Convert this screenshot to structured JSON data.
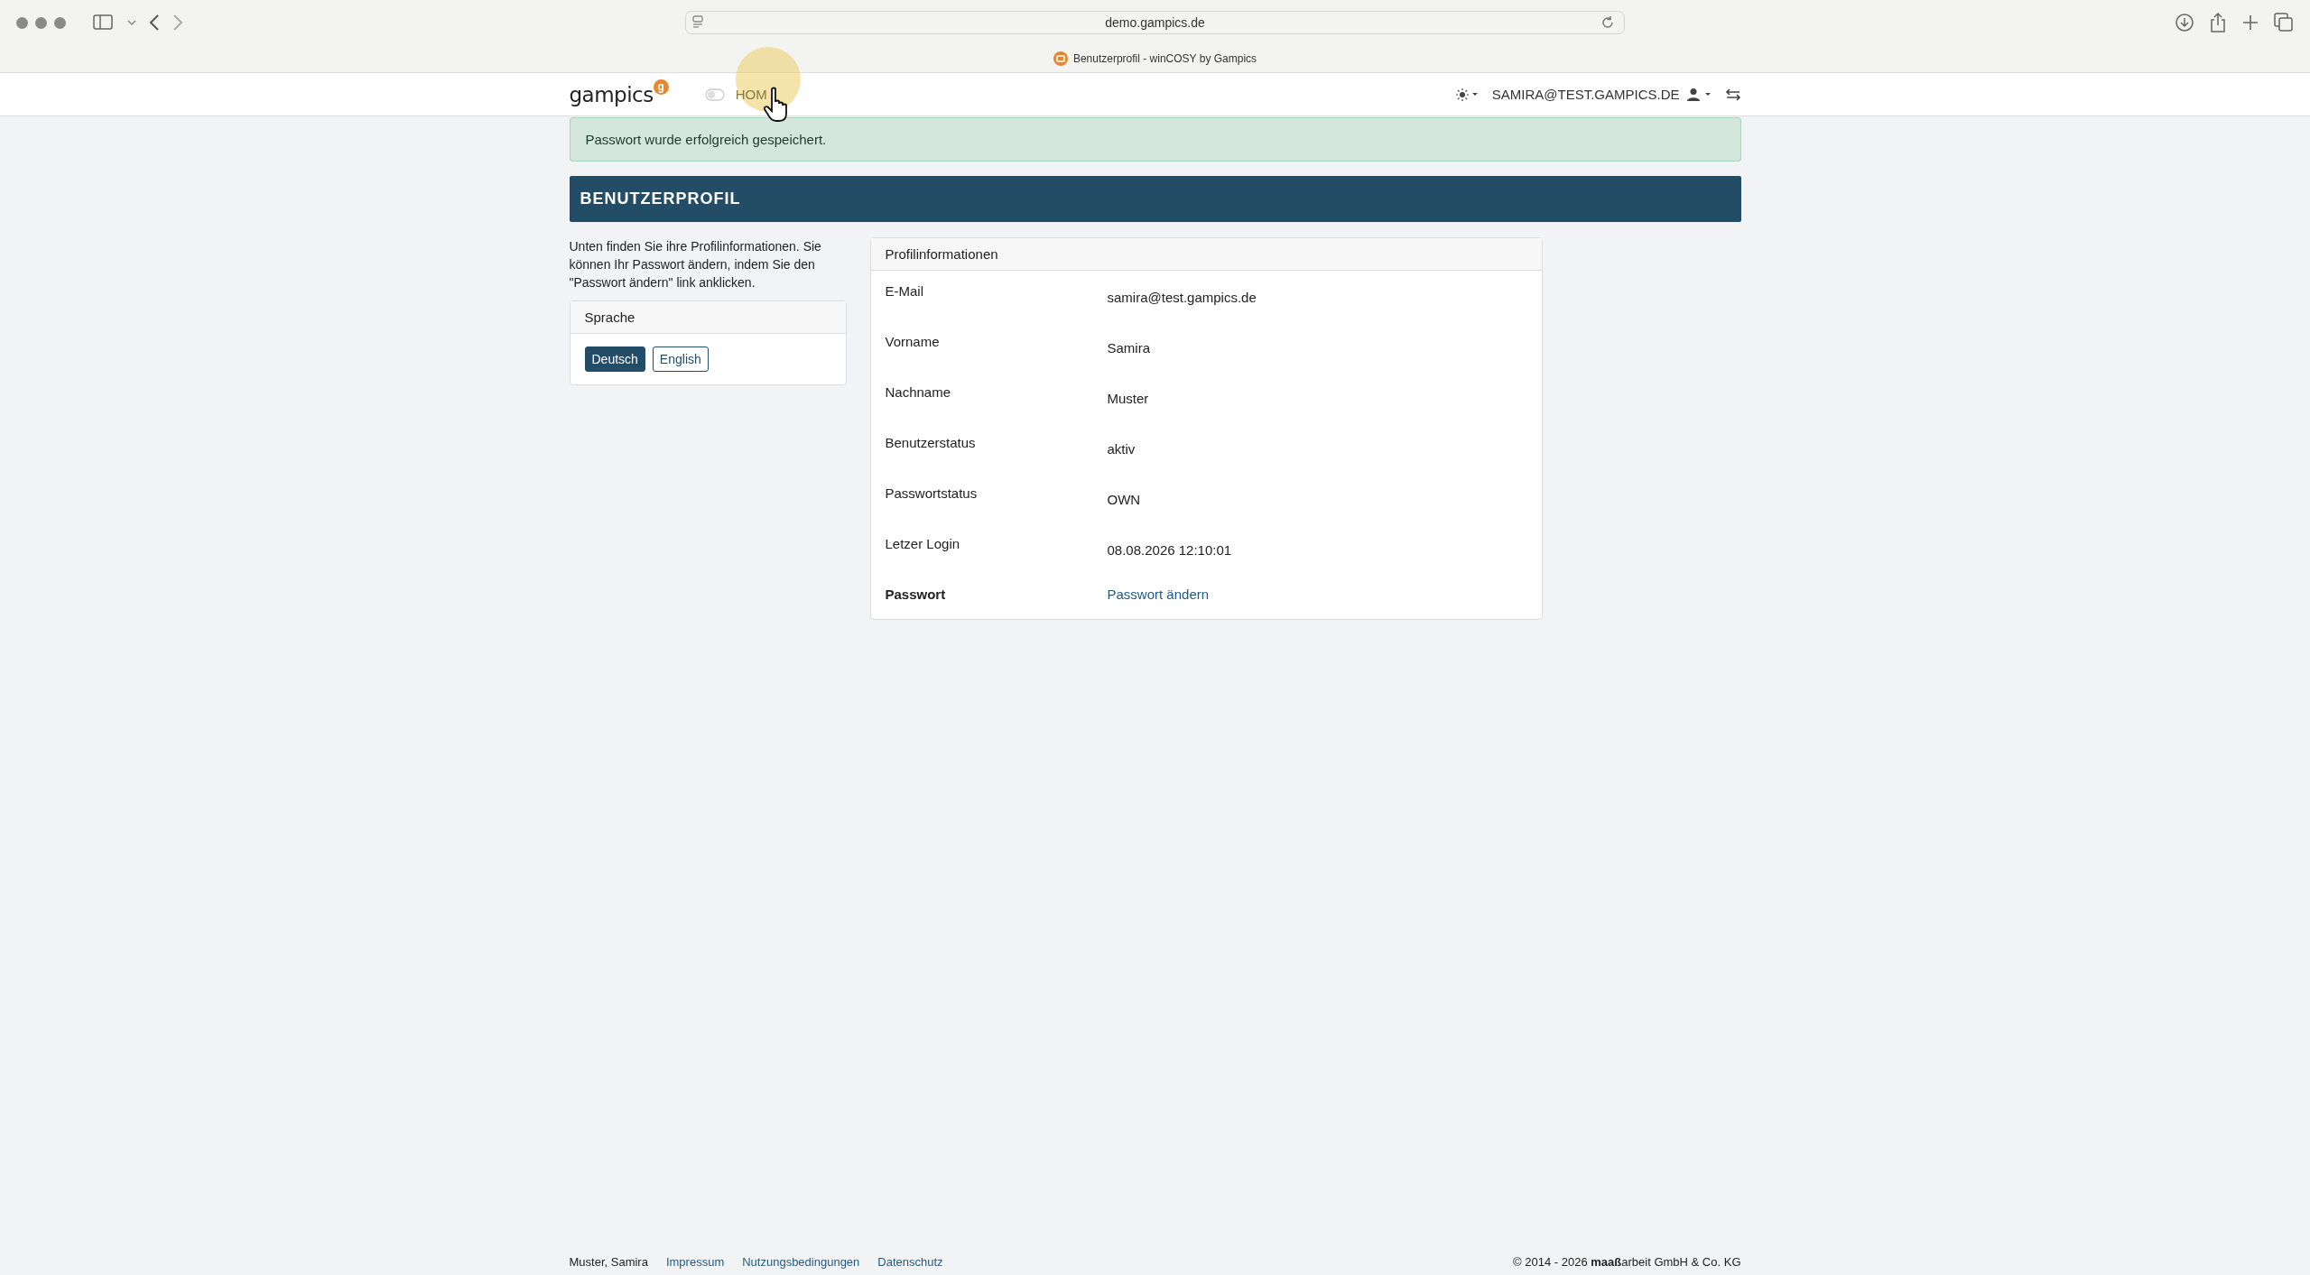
{
  "browser": {
    "url": "demo.gampics.de",
    "tab_title": "Benutzerprofil - winCOSY by Gampics"
  },
  "navbar": {
    "brand": "gampics",
    "brand_badge": "g",
    "nav_items": [
      {
        "label": "HOM"
      }
    ],
    "user": "SAMIRA@TEST.GAMPICS.DE"
  },
  "alert": "Passwort wurde erfolgreich gespeichert.",
  "page_title": "BENUTZERPROFIL",
  "intro": "Unten finden Sie ihre Profilinformationen. Sie können Ihr Passwort ändern, indem Sie den \"Passwort ändern\" link anklicken.",
  "language_card": {
    "title": "Sprache",
    "buttons": [
      {
        "label": "Deutsch",
        "selected": true
      },
      {
        "label": "English",
        "selected": false
      }
    ]
  },
  "profile_card": {
    "title": "Profilinformationen",
    "rows": [
      {
        "label": "E-Mail",
        "value": "samira@test.gampics.de",
        "kind": "text"
      },
      {
        "label": "Vorname",
        "value": "Samira",
        "kind": "text"
      },
      {
        "label": "Nachname",
        "value": "Muster",
        "kind": "text"
      },
      {
        "label": "Benutzerstatus",
        "value": "aktiv",
        "kind": "text"
      },
      {
        "label": "Passwortstatus",
        "value": "OWN",
        "kind": "text"
      },
      {
        "label": "Letzer Login",
        "value": "08.08.2026 12:10:01",
        "kind": "text"
      },
      {
        "label": "Passwort",
        "value": "Passwort ändern",
        "kind": "link"
      }
    ]
  },
  "footer": {
    "user": "Muster, Samira",
    "links": [
      "Impressum",
      "Nutzungsbedingungen",
      "Datenschutz"
    ],
    "copyright": "© 2014 - 2026 **maaß**arbeit GmbH & Co. KG"
  }
}
